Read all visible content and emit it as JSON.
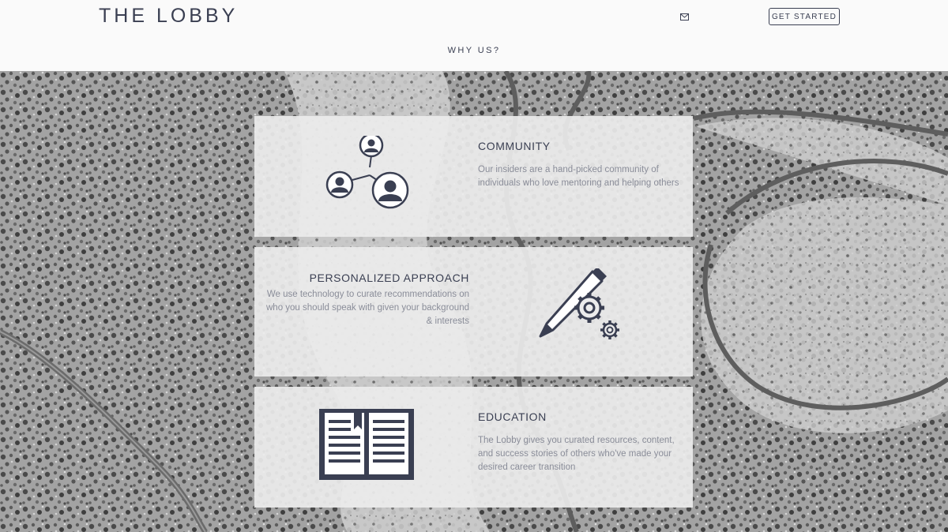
{
  "header": {
    "logo": "THE LOBBY",
    "cta_label": "GET STARTED",
    "mail_icon": "envelope-icon"
  },
  "nav": {
    "section_title": "WHY US?"
  },
  "features": [
    {
      "title": "COMMUNITY",
      "body": "Our insiders are a hand-picked community of individuals who love mentoring and helping others",
      "icon": "community-network-icon"
    },
    {
      "title": "PERSONALIZED APPROACH",
      "body": "We use technology to curate recommendations on who you should speak with given your background & interests",
      "icon": "pencil-gears-icon"
    },
    {
      "title": "EDUCATION",
      "body": "The Lobby gives you curated resources, content, and success stories of others who've made your desired career transition",
      "icon": "open-book-icon"
    }
  ],
  "colors": {
    "text_dark": "#3a3f52",
    "text_muted": "#8a8d99",
    "card_bg": "#ececec",
    "header_bg": "#fafafa"
  }
}
